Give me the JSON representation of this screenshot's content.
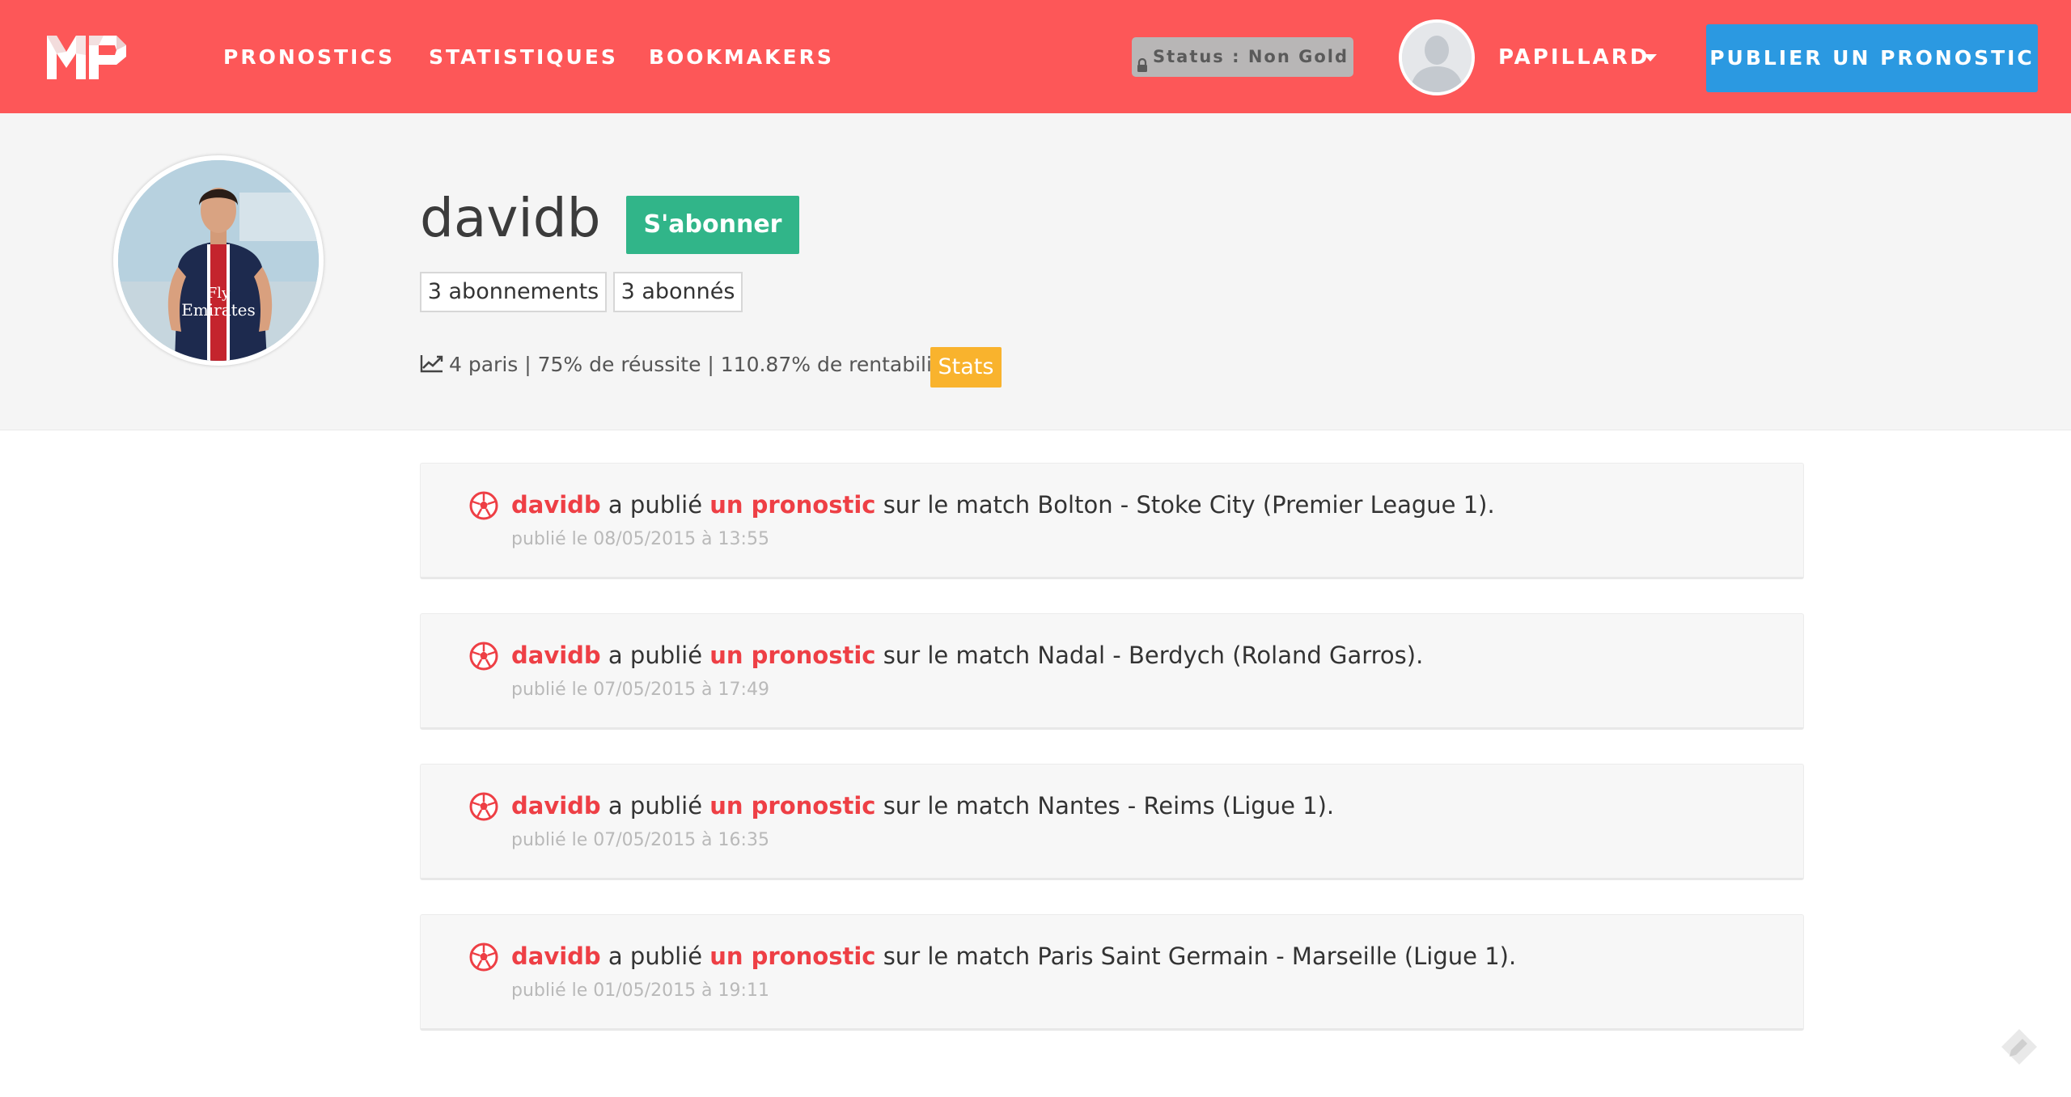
{
  "brand": {
    "logo_text": "MP",
    "primary_color": "#fd5758"
  },
  "nav": {
    "links": [
      "PRONOSTICS",
      "STATISTIQUES",
      "BOOKMAKERS"
    ],
    "status": "Status : Non Gold",
    "user": "PAPILLARD",
    "publish": "PUBLIER UN PRONOSTIC"
  },
  "profile": {
    "username": "davidb",
    "subscribe": "S'abonner",
    "subscriptions": "3 abonnements",
    "subscribers": "3 abonnés",
    "stats_text": "4 paris | 75% de réussite | 110.87% de rentabilité",
    "stats_button": "Stats"
  },
  "feed": [
    {
      "user": "davidb",
      "verb": " a publié ",
      "link": "un pronostic",
      "rest": " sur le match Bolton - Stoke City (Premier League 1).",
      "date": "publié le 08/05/2015 à 13:55"
    },
    {
      "user": "davidb",
      "verb": " a publié ",
      "link": "un pronostic",
      "rest": " sur le match Nadal - Berdych (Roland Garros).",
      "date": "publié le 07/05/2015 à 17:49"
    },
    {
      "user": "davidb",
      "verb": " a publié ",
      "link": "un pronostic",
      "rest": " sur le match Nantes - Reims (Ligue 1).",
      "date": "publié le 07/05/2015 à 16:35"
    },
    {
      "user": "davidb",
      "verb": " a publié ",
      "link": "un pronostic",
      "rest": " sur le match Paris Saint Germain - Marseille (Ligue 1).",
      "date": "publié le 01/05/2015 à 19:11"
    }
  ],
  "colors": {
    "accent_red": "#ee3f45",
    "publish_blue": "#2b99e1",
    "subscribe_green": "#31b589",
    "stats_orange": "#f9b32d"
  },
  "icons": [
    "logo",
    "lock-icon",
    "user-avatar",
    "caret-down-icon",
    "profile-photo",
    "chart-line-icon",
    "soccer-ball-icon",
    "feedback-icon"
  ]
}
